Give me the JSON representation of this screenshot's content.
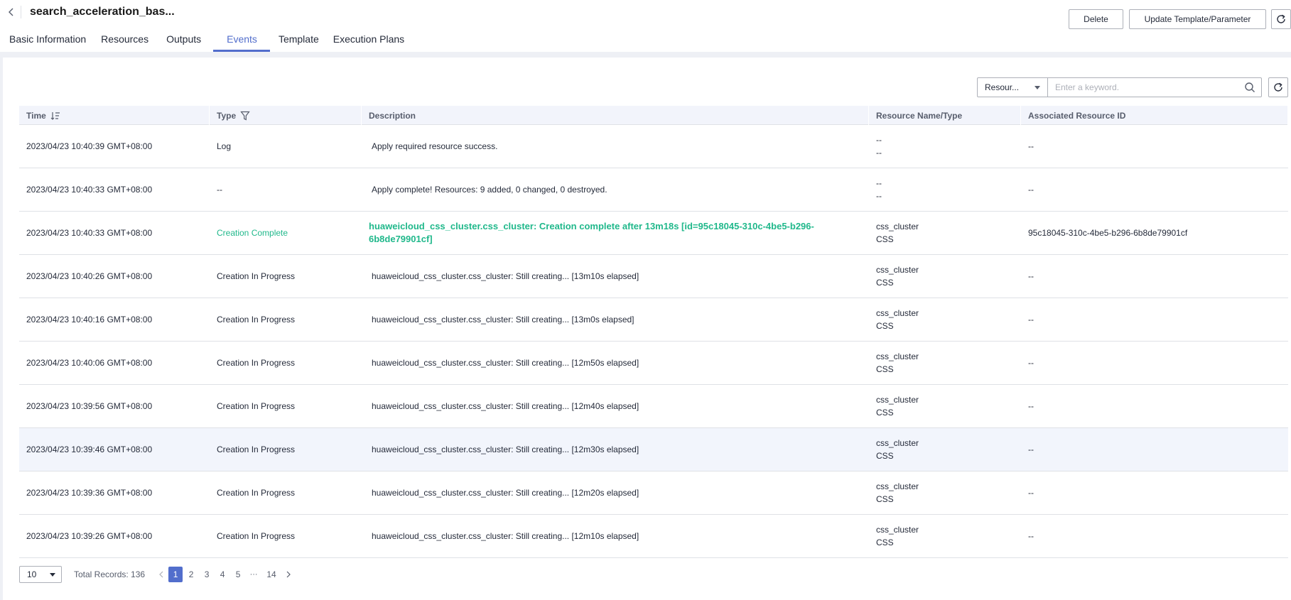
{
  "header": {
    "title": "search_acceleration_bas...",
    "delete_label": "Delete",
    "update_label": "Update Template/Parameter"
  },
  "tabs": [
    {
      "label": "Basic Information"
    },
    {
      "label": "Resources"
    },
    {
      "label": "Outputs"
    },
    {
      "label": "Events",
      "active": true
    },
    {
      "label": "Template"
    },
    {
      "label": "Execution Plans"
    }
  ],
  "toolbar": {
    "filter_value": "Resour...",
    "search_placeholder": "Enter a keyword."
  },
  "table": {
    "columns": [
      "Time",
      "Type",
      "Description",
      "Resource Name/Type",
      "Associated Resource ID"
    ],
    "rows": [
      {
        "time": "2023/04/23 10:40:39 GMT+08:00",
        "type": "Log",
        "desc": "Apply required resource success.",
        "res_name": "--",
        "res_type": "--",
        "res_id": "--"
      },
      {
        "time": "2023/04/23 10:40:33 GMT+08:00",
        "type": "--",
        "desc": "Apply complete! Resources: 9 added, 0 changed, 0 destroyed.",
        "res_name": "--",
        "res_type": "--",
        "res_id": "--"
      },
      {
        "time": "2023/04/23 10:40:33 GMT+08:00",
        "type": "Creation Complete",
        "desc": "huaweicloud_css_cluster.css_cluster: Creation complete after 13m18s [id=95c18045-310c-4be5-b296-6b8de79901cf]",
        "res_name": "css_cluster",
        "res_type": "CSS",
        "res_id": "95c18045-310c-4be5-b296-6b8de79901cf"
      },
      {
        "time": "2023/04/23 10:40:26 GMT+08:00",
        "type": "Creation In Progress",
        "desc": "huaweicloud_css_cluster.css_cluster: Still creating... [13m10s elapsed]",
        "res_name": "css_cluster",
        "res_type": "CSS",
        "res_id": "--"
      },
      {
        "time": "2023/04/23 10:40:16 GMT+08:00",
        "type": "Creation In Progress",
        "desc": "huaweicloud_css_cluster.css_cluster: Still creating... [13m0s elapsed]",
        "res_name": "css_cluster",
        "res_type": "CSS",
        "res_id": "--"
      },
      {
        "time": "2023/04/23 10:40:06 GMT+08:00",
        "type": "Creation In Progress",
        "desc": "huaweicloud_css_cluster.css_cluster: Still creating... [12m50s elapsed]",
        "res_name": "css_cluster",
        "res_type": "CSS",
        "res_id": "--"
      },
      {
        "time": "2023/04/23 10:39:56 GMT+08:00",
        "type": "Creation In Progress",
        "desc": "huaweicloud_css_cluster.css_cluster: Still creating... [12m40s elapsed]",
        "res_name": "css_cluster",
        "res_type": "CSS",
        "res_id": "--"
      },
      {
        "time": "2023/04/23 10:39:46 GMT+08:00",
        "type": "Creation In Progress",
        "desc": "huaweicloud_css_cluster.css_cluster: Still creating... [12m30s elapsed]",
        "res_name": "css_cluster",
        "res_type": "CSS",
        "res_id": "--"
      },
      {
        "time": "2023/04/23 10:39:36 GMT+08:00",
        "type": "Creation In Progress",
        "desc": "huaweicloud_css_cluster.css_cluster: Still creating... [12m20s elapsed]",
        "res_name": "css_cluster",
        "res_type": "CSS",
        "res_id": "--"
      },
      {
        "time": "2023/04/23 10:39:26 GMT+08:00",
        "type": "Creation In Progress",
        "desc": "huaweicloud_css_cluster.css_cluster: Still creating... [12m10s elapsed]",
        "res_name": "css_cluster",
        "res_type": "CSS",
        "res_id": "--"
      }
    ]
  },
  "pagination": {
    "page_size": "10",
    "total_label": "Total Records: 136",
    "pages": [
      "1",
      "2",
      "3",
      "4",
      "5"
    ],
    "ellipsis": "···",
    "last_page": "14",
    "current": "1"
  },
  "colors": {
    "accent": "#526ecc",
    "success": "#20b88b",
    "header_bg": "#f2f4fb",
    "page_bg": "#eef0f5"
  },
  "icons": [
    "back-icon",
    "refresh-icon",
    "sort-icon",
    "filter-icon",
    "search-icon",
    "chevron-left-icon",
    "chevron-right-icon"
  ]
}
